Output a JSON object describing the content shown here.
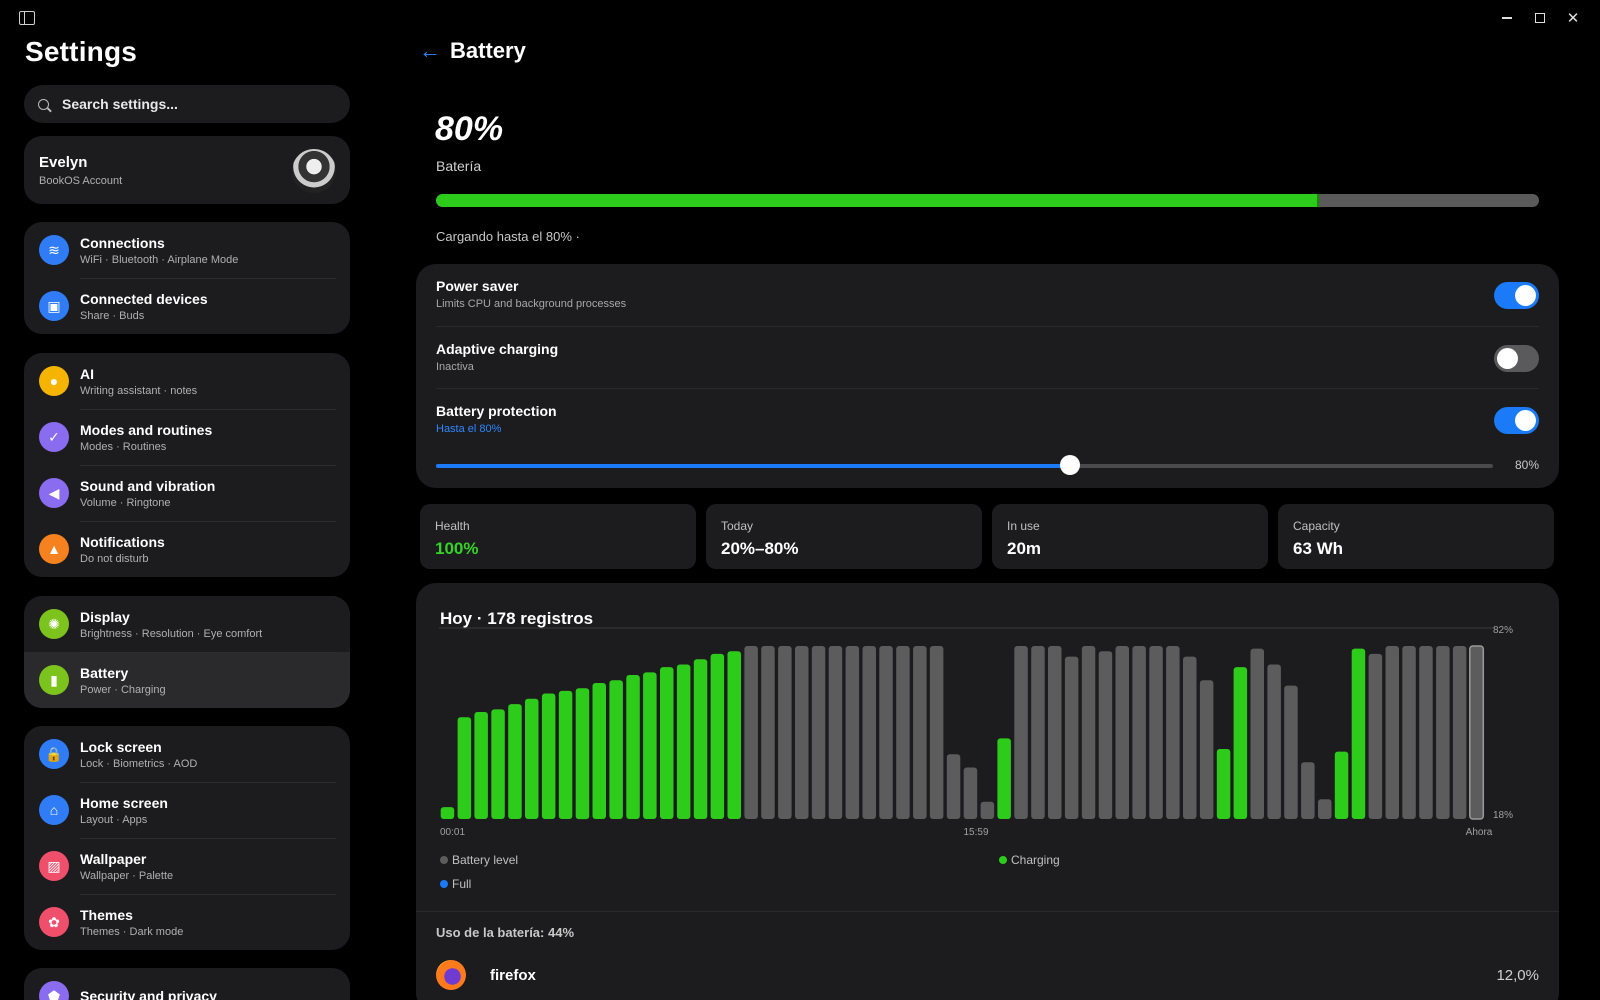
{
  "sidebar": {
    "title": "Settings",
    "search_placeholder": "Search settings...",
    "account": {
      "name": "Evelyn",
      "sub": "BookOS Account"
    },
    "groups": [
      [
        {
          "label": "Connections",
          "sub": "WiFi · Bluetooth · Airplane Mode",
          "icon": "wifi-icon",
          "color": "#2f7cf6",
          "glyph": "≋"
        },
        {
          "label": "Connected devices",
          "sub": "Share · Buds",
          "icon": "devices-icon",
          "color": "#2f7cf6",
          "glyph": "▣"
        }
      ],
      [
        {
          "label": "AI",
          "sub": "Writing assistant · notes",
          "icon": "lightbulb-icon",
          "color": "#f5b400",
          "glyph": "●"
        },
        {
          "label": "Modes and routines",
          "sub": "Modes · Routines",
          "icon": "routine-icon",
          "color": "#8a6cf0",
          "glyph": "✓"
        },
        {
          "label": "Sound and vibration",
          "sub": "Volume · Ringtone",
          "icon": "speaker-icon",
          "color": "#8a6cf0",
          "glyph": "◀"
        },
        {
          "label": "Notifications",
          "sub": "Do not disturb",
          "icon": "bell-icon",
          "color": "#f5821f",
          "glyph": "▲"
        }
      ],
      [
        {
          "label": "Display",
          "sub": "Brightness · Resolution · Eye comfort",
          "icon": "sun-icon",
          "color": "#7cc31d",
          "glyph": "✺"
        },
        {
          "label": "Battery",
          "sub": "Power · Charging",
          "icon": "battery-icon",
          "color": "#7cc31d",
          "glyph": "▮",
          "active": true
        }
      ],
      [
        {
          "label": "Lock screen",
          "sub": "Lock · Biometrics · AOD",
          "icon": "lock-icon",
          "color": "#2f7cf6",
          "glyph": "🔒"
        },
        {
          "label": "Home screen",
          "sub": "Layout · Apps",
          "icon": "home-icon",
          "color": "#2f7cf6",
          "glyph": "⌂"
        },
        {
          "label": "Wallpaper",
          "sub": "Wallpaper · Palette",
          "icon": "image-icon",
          "color": "#ef4f6b",
          "glyph": "▨"
        },
        {
          "label": "Themes",
          "sub": "Themes · Dark mode",
          "icon": "palette-icon",
          "color": "#ef4f6b",
          "glyph": "✿"
        }
      ],
      [
        {
          "label": "Security and privacy",
          "sub": "",
          "icon": "shield-icon",
          "color": "#8a6cf0",
          "glyph": "⬟"
        }
      ]
    ]
  },
  "main": {
    "title": "Battery",
    "level_text": "80%",
    "level_label": "Batería",
    "level_fraction": 0.8,
    "charging_note": "Cargando hasta el 80% ·",
    "toggles": [
      {
        "label": "Power saver",
        "sub": "Limits CPU and background processes",
        "on": true,
        "sub_blue": false
      },
      {
        "label": "Adaptive charging",
        "sub": "Inactiva",
        "on": false,
        "sub_blue": false
      },
      {
        "label": "Battery protection",
        "sub": "Hasta el 80%",
        "on": true,
        "sub_blue": true
      }
    ],
    "protection_slider": {
      "value_fraction": 0.6,
      "value_text": "80%"
    },
    "stats": [
      {
        "label": "Health",
        "value": "100%",
        "green": true
      },
      {
        "label": "Today",
        "value": "20%–80%",
        "green": false
      },
      {
        "label": "In use",
        "value": "20m",
        "green": false
      },
      {
        "label": "Capacity",
        "value": "63 Wh",
        "green": false
      }
    ],
    "usage_title": "Uso de la batería: 44%",
    "apps": [
      {
        "name": "firefox",
        "percent": "12,0%",
        "icon": "firefox-icon"
      }
    ]
  },
  "colors": {
    "accent": "#1a7af8",
    "charging": "#2ecc1a",
    "level": "#5c5c5c",
    "full": "#1a7af8"
  },
  "chart_data": {
    "type": "bar",
    "title": "Hoy · 178 registros",
    "x_tick_labels": [
      "00:01",
      "15:59",
      "Ahora"
    ],
    "y_tick_labels": [
      "82%",
      "18%"
    ],
    "legend": [
      "Battery level",
      "Charging",
      "Full"
    ],
    "legend_colors": [
      "#5c5c5c",
      "#2ecc1a",
      "#1a7af8"
    ],
    "ylim": [
      18,
      82
    ],
    "values": [
      21,
      55,
      57,
      58,
      60,
      62,
      64,
      65,
      66,
      68,
      69,
      71,
      72,
      74,
      75,
      77,
      79,
      80,
      82,
      82,
      82,
      82,
      82,
      82,
      82,
      82,
      82,
      82,
      82,
      82,
      41,
      36,
      23,
      47,
      82,
      82,
      82,
      78,
      82,
      80,
      82,
      82,
      82,
      82,
      78,
      69,
      43,
      74,
      81,
      75,
      67,
      38,
      24,
      42,
      81,
      79,
      82,
      82,
      82,
      82,
      82,
      82
    ],
    "charging": [
      true,
      true,
      true,
      true,
      true,
      true,
      true,
      true,
      true,
      true,
      true,
      true,
      true,
      true,
      true,
      true,
      true,
      true,
      false,
      false,
      false,
      false,
      false,
      false,
      false,
      false,
      false,
      false,
      false,
      false,
      false,
      false,
      false,
      true,
      false,
      false,
      false,
      false,
      false,
      false,
      false,
      false,
      false,
      false,
      false,
      false,
      true,
      true,
      false,
      false,
      false,
      false,
      false,
      true,
      true,
      false,
      false,
      false,
      false,
      false,
      false,
      false
    ]
  }
}
